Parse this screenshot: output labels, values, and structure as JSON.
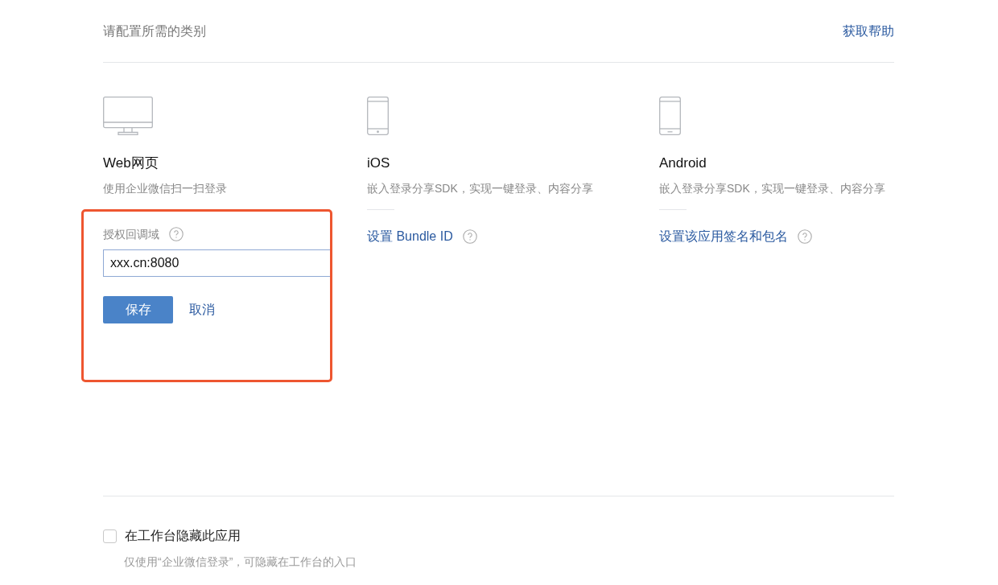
{
  "header": {
    "title": "请配置所需的类别",
    "help_link": "获取帮助"
  },
  "platforms": [
    {
      "kind": "web",
      "title": "Web网页",
      "description": "使用企业微信扫一扫登录",
      "form": {
        "label": "授权回调域",
        "value": "xxx.cn:8080",
        "save": "保存",
        "cancel": "取消"
      }
    },
    {
      "kind": "ios",
      "title": "iOS",
      "description": "嵌入登录分享SDK，实现一键登录、内容分享",
      "link": "设置 Bundle ID"
    },
    {
      "kind": "android",
      "title": "Android",
      "description": "嵌入登录分享SDK，实现一键登录、内容分享",
      "link": "设置该应用签名和包名"
    }
  ],
  "hide_option": {
    "label": "在工作台隐藏此应用",
    "checked": false,
    "hint": "仅使用“企业微信登录”，可隐藏在工作台的入口"
  }
}
